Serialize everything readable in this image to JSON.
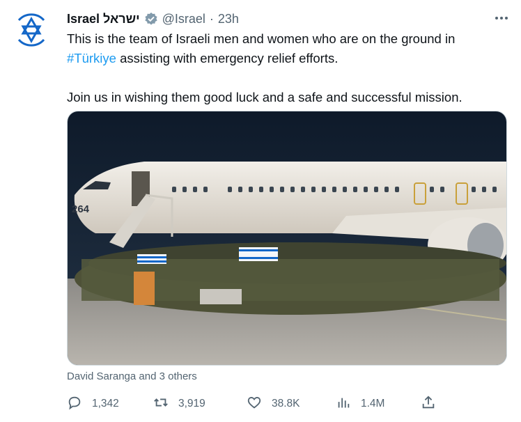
{
  "author": {
    "name": "Israel ישראל",
    "handle": "@Israel",
    "separator": "·",
    "time": "23h",
    "verified_icon": "verified-badge-icon",
    "avatar_icon": "star-of-david-icon"
  },
  "tweet": {
    "line1": "This is the team of Israeli men and women who are on the ground in",
    "hashtag": "#Türkiye",
    "line2_rest": " assisting with emergency relief efforts.",
    "line3": "Join us in wishing them good luck and a safe and successful mission."
  },
  "media": {
    "aircraft_number": "264"
  },
  "liked_by": "David Saranga and 3 others",
  "actions": {
    "replies": "1,342",
    "retweets": "3,919",
    "likes": "38.8K",
    "views": "1.4M"
  },
  "colors": {
    "accent": "#1d9bf0",
    "muted": "#536471",
    "text": "#0f1419",
    "flag_blue": "#1467c8"
  }
}
